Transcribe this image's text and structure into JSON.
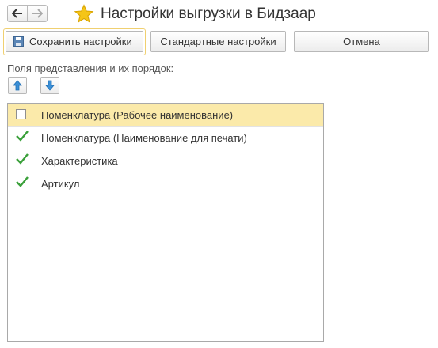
{
  "header": {
    "title": "Настройки выгрузки в Бидзаар"
  },
  "toolbar": {
    "save_label": "Сохранить настройки",
    "standard_label": "Стандартные настройки",
    "cancel_label": "Отмена"
  },
  "fields": {
    "label": "Поля представления и их порядок:",
    "rows": [
      {
        "label": "Номенклатура (Рабочее наименование)",
        "checked": false,
        "selected": true
      },
      {
        "label": "Номенклатура (Наименование для печати)",
        "checked": true,
        "selected": false
      },
      {
        "label": "Характеристика",
        "checked": true,
        "selected": false
      },
      {
        "label": "Артикул",
        "checked": true,
        "selected": false
      }
    ]
  },
  "colors": {
    "accent_star": "#f5c518",
    "check": "#3aa03a",
    "selected_row": "#fbeaaa",
    "arrow_blue": "#3b8fd6"
  },
  "icons": {
    "back": "arrow-left-icon",
    "forward": "arrow-right-icon",
    "favorite": "star-icon",
    "save": "floppy-icon",
    "move_up": "arrow-up-icon",
    "move_down": "arrow-down-icon"
  }
}
